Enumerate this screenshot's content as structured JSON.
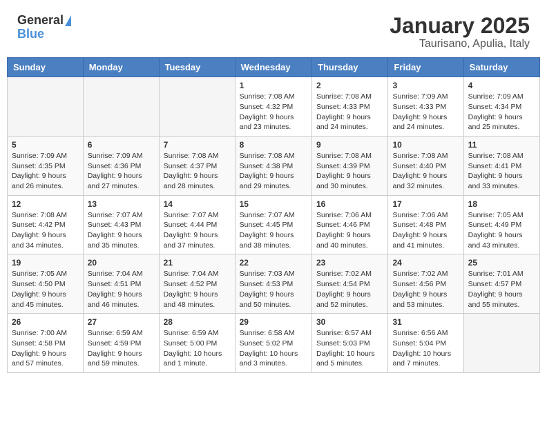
{
  "header": {
    "logo_general": "General",
    "logo_blue": "Blue",
    "title": "January 2025",
    "subtitle": "Taurisano, Apulia, Italy"
  },
  "weekdays": [
    "Sunday",
    "Monday",
    "Tuesday",
    "Wednesday",
    "Thursday",
    "Friday",
    "Saturday"
  ],
  "weeks": [
    [
      {
        "day": "",
        "info": ""
      },
      {
        "day": "",
        "info": ""
      },
      {
        "day": "",
        "info": ""
      },
      {
        "day": "1",
        "info": "Sunrise: 7:08 AM\nSunset: 4:32 PM\nDaylight: 9 hours and 23 minutes."
      },
      {
        "day": "2",
        "info": "Sunrise: 7:08 AM\nSunset: 4:33 PM\nDaylight: 9 hours and 24 minutes."
      },
      {
        "day": "3",
        "info": "Sunrise: 7:09 AM\nSunset: 4:33 PM\nDaylight: 9 hours and 24 minutes."
      },
      {
        "day": "4",
        "info": "Sunrise: 7:09 AM\nSunset: 4:34 PM\nDaylight: 9 hours and 25 minutes."
      }
    ],
    [
      {
        "day": "5",
        "info": "Sunrise: 7:09 AM\nSunset: 4:35 PM\nDaylight: 9 hours and 26 minutes."
      },
      {
        "day": "6",
        "info": "Sunrise: 7:09 AM\nSunset: 4:36 PM\nDaylight: 9 hours and 27 minutes."
      },
      {
        "day": "7",
        "info": "Sunrise: 7:08 AM\nSunset: 4:37 PM\nDaylight: 9 hours and 28 minutes."
      },
      {
        "day": "8",
        "info": "Sunrise: 7:08 AM\nSunset: 4:38 PM\nDaylight: 9 hours and 29 minutes."
      },
      {
        "day": "9",
        "info": "Sunrise: 7:08 AM\nSunset: 4:39 PM\nDaylight: 9 hours and 30 minutes."
      },
      {
        "day": "10",
        "info": "Sunrise: 7:08 AM\nSunset: 4:40 PM\nDaylight: 9 hours and 32 minutes."
      },
      {
        "day": "11",
        "info": "Sunrise: 7:08 AM\nSunset: 4:41 PM\nDaylight: 9 hours and 33 minutes."
      }
    ],
    [
      {
        "day": "12",
        "info": "Sunrise: 7:08 AM\nSunset: 4:42 PM\nDaylight: 9 hours and 34 minutes."
      },
      {
        "day": "13",
        "info": "Sunrise: 7:07 AM\nSunset: 4:43 PM\nDaylight: 9 hours and 35 minutes."
      },
      {
        "day": "14",
        "info": "Sunrise: 7:07 AM\nSunset: 4:44 PM\nDaylight: 9 hours and 37 minutes."
      },
      {
        "day": "15",
        "info": "Sunrise: 7:07 AM\nSunset: 4:45 PM\nDaylight: 9 hours and 38 minutes."
      },
      {
        "day": "16",
        "info": "Sunrise: 7:06 AM\nSunset: 4:46 PM\nDaylight: 9 hours and 40 minutes."
      },
      {
        "day": "17",
        "info": "Sunrise: 7:06 AM\nSunset: 4:48 PM\nDaylight: 9 hours and 41 minutes."
      },
      {
        "day": "18",
        "info": "Sunrise: 7:05 AM\nSunset: 4:49 PM\nDaylight: 9 hours and 43 minutes."
      }
    ],
    [
      {
        "day": "19",
        "info": "Sunrise: 7:05 AM\nSunset: 4:50 PM\nDaylight: 9 hours and 45 minutes."
      },
      {
        "day": "20",
        "info": "Sunrise: 7:04 AM\nSunset: 4:51 PM\nDaylight: 9 hours and 46 minutes."
      },
      {
        "day": "21",
        "info": "Sunrise: 7:04 AM\nSunset: 4:52 PM\nDaylight: 9 hours and 48 minutes."
      },
      {
        "day": "22",
        "info": "Sunrise: 7:03 AM\nSunset: 4:53 PM\nDaylight: 9 hours and 50 minutes."
      },
      {
        "day": "23",
        "info": "Sunrise: 7:02 AM\nSunset: 4:54 PM\nDaylight: 9 hours and 52 minutes."
      },
      {
        "day": "24",
        "info": "Sunrise: 7:02 AM\nSunset: 4:56 PM\nDaylight: 9 hours and 53 minutes."
      },
      {
        "day": "25",
        "info": "Sunrise: 7:01 AM\nSunset: 4:57 PM\nDaylight: 9 hours and 55 minutes."
      }
    ],
    [
      {
        "day": "26",
        "info": "Sunrise: 7:00 AM\nSunset: 4:58 PM\nDaylight: 9 hours and 57 minutes."
      },
      {
        "day": "27",
        "info": "Sunrise: 6:59 AM\nSunset: 4:59 PM\nDaylight: 9 hours and 59 minutes."
      },
      {
        "day": "28",
        "info": "Sunrise: 6:59 AM\nSunset: 5:00 PM\nDaylight: 10 hours and 1 minute."
      },
      {
        "day": "29",
        "info": "Sunrise: 6:58 AM\nSunset: 5:02 PM\nDaylight: 10 hours and 3 minutes."
      },
      {
        "day": "30",
        "info": "Sunrise: 6:57 AM\nSunset: 5:03 PM\nDaylight: 10 hours and 5 minutes."
      },
      {
        "day": "31",
        "info": "Sunrise: 6:56 AM\nSunset: 5:04 PM\nDaylight: 10 hours and 7 minutes."
      },
      {
        "day": "",
        "info": ""
      }
    ]
  ]
}
